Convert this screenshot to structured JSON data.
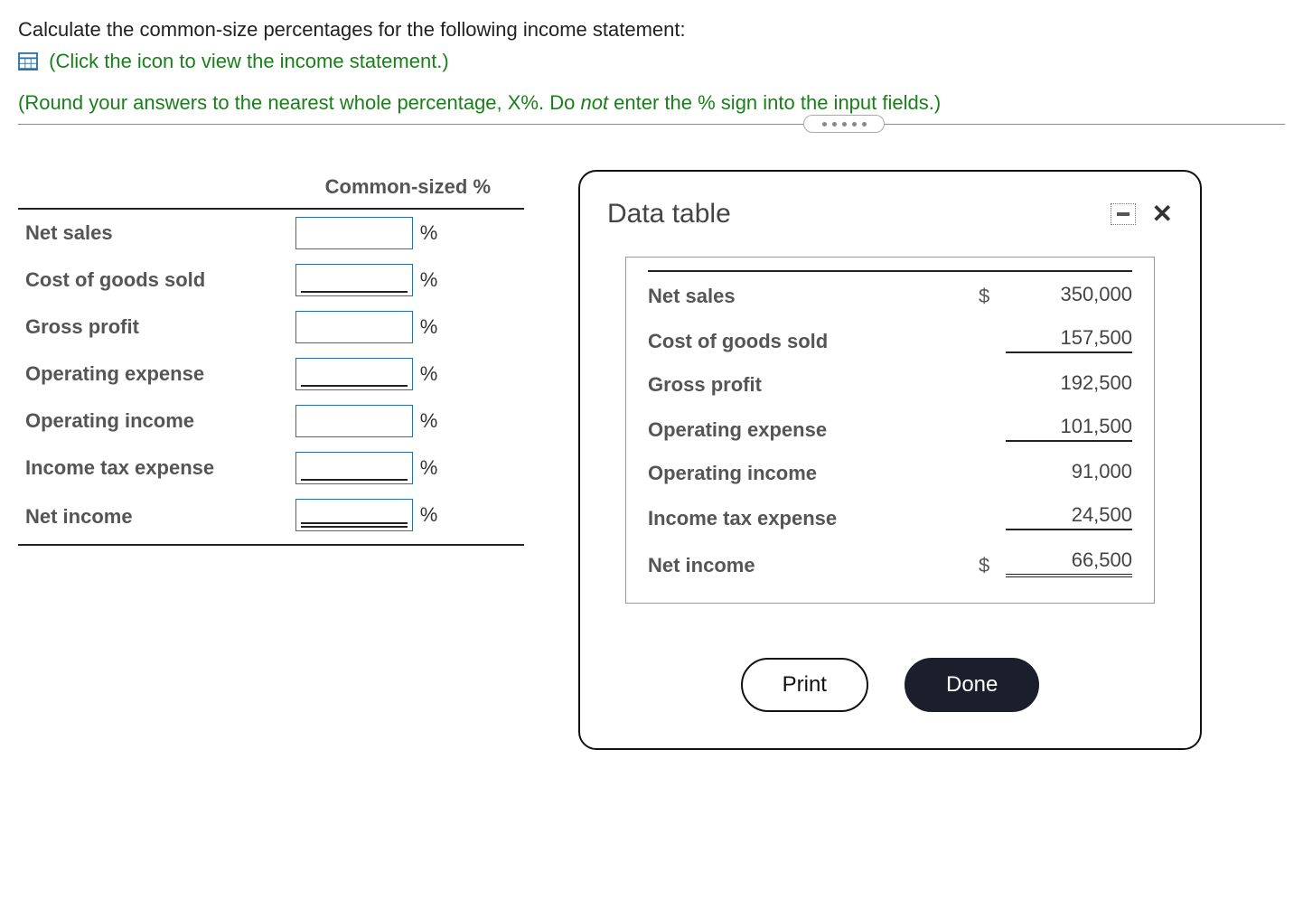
{
  "question": {
    "prompt": "Calculate the common-size percentages for the following income statement:",
    "icon_hint": "(Click the icon to view the income statement.)",
    "round_hint_pre": "(Round your answers to the nearest whole percentage, X%. Do ",
    "round_hint_em": "not",
    "round_hint_post": " enter the % sign into the input fields.)"
  },
  "answer_table": {
    "header": "Common-sized %",
    "pct_sign": "%",
    "rows": [
      {
        "label": "Net sales",
        "underline": "none"
      },
      {
        "label": "Cost of goods sold",
        "underline": "single"
      },
      {
        "label": "Gross profit",
        "underline": "none"
      },
      {
        "label": "Operating expense",
        "underline": "single"
      },
      {
        "label": "Operating income",
        "underline": "none"
      },
      {
        "label": "Income tax expense",
        "underline": "single"
      },
      {
        "label": "Net income",
        "underline": "double"
      }
    ]
  },
  "modal": {
    "title": "Data table",
    "print_label": "Print",
    "done_label": "Done"
  },
  "chart_data": {
    "type": "table",
    "title": "Data table",
    "currency": "$",
    "rows": [
      {
        "label": "Net sales",
        "value": "350,000",
        "show_currency": true,
        "underline": "none",
        "top_rule": true
      },
      {
        "label": "Cost of goods sold",
        "value": "157,500",
        "show_currency": false,
        "underline": "single",
        "top_rule": false
      },
      {
        "label": "Gross profit",
        "value": "192,500",
        "show_currency": false,
        "underline": "none",
        "top_rule": false
      },
      {
        "label": "Operating expense",
        "value": "101,500",
        "show_currency": false,
        "underline": "single",
        "top_rule": false
      },
      {
        "label": "Operating income",
        "value": "91,000",
        "show_currency": false,
        "underline": "none",
        "top_rule": false
      },
      {
        "label": "Income tax expense",
        "value": "24,500",
        "show_currency": false,
        "underline": "single",
        "top_rule": false
      },
      {
        "label": "Net income",
        "value": "66,500",
        "show_currency": true,
        "underline": "double",
        "top_rule": false
      }
    ]
  }
}
